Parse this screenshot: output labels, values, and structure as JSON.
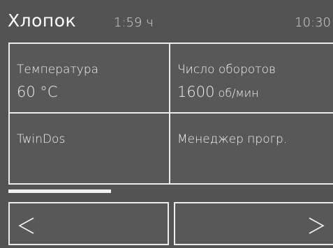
{
  "status_bar": {
    "program_name": "Хлопок",
    "program_duration": "1:59 ч",
    "clock": "10:30"
  },
  "tiles": [
    {
      "label": "Температура",
      "value": "60 °C",
      "unit": ""
    },
    {
      "label": "Число оборотов",
      "value": "1600",
      "unit": " об/мин"
    },
    {
      "label": "TwinDos",
      "value": "",
      "unit": ""
    },
    {
      "label": "Менеджер прогр.",
      "value": "",
      "unit": ""
    }
  ],
  "navigation": {
    "prev_icon": "chevron-left-icon",
    "next_icon": "chevron-right-icon"
  },
  "page_indicator": {
    "current_page": 1,
    "total_pages": 3
  },
  "colors": {
    "background": "#535353",
    "border": "#ececec",
    "text": "#f2f2f2"
  }
}
